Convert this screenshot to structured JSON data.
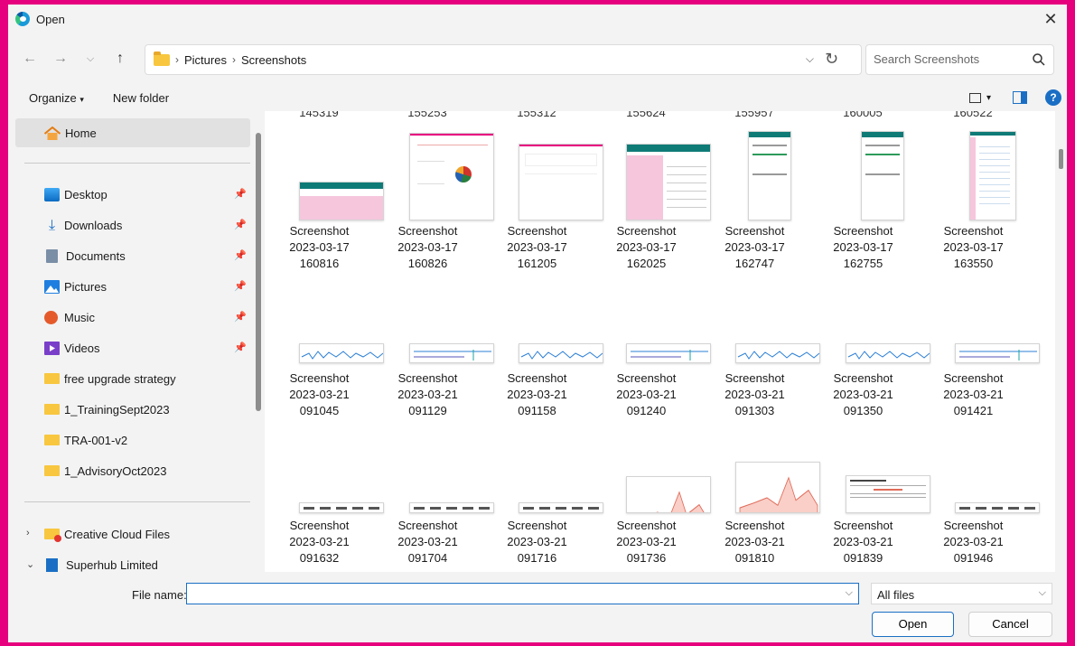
{
  "window": {
    "title": "Open"
  },
  "nav": {
    "back_icon": "arrow-left-icon",
    "forward_icon": "arrow-right-icon",
    "recent_icon": "chevron-down-icon",
    "up_icon": "arrow-up-icon",
    "breadcrumbs": [
      "Pictures",
      "Screenshots"
    ],
    "search_placeholder": "Search Screenshots"
  },
  "commands": {
    "organize": "Organize",
    "new_folder": "New folder"
  },
  "sidebar": {
    "home": "Home",
    "quick_access": [
      {
        "label": "Desktop",
        "icon": "desktop-icon"
      },
      {
        "label": "Downloads",
        "icon": "download-icon"
      },
      {
        "label": "Documents",
        "icon": "documents-icon"
      },
      {
        "label": "Pictures",
        "icon": "pictures-icon"
      },
      {
        "label": "Music",
        "icon": "music-icon"
      },
      {
        "label": "Videos",
        "icon": "videos-icon"
      }
    ],
    "folders": [
      "free upgrade strategy",
      "1_TrainingSept2023",
      "TRA-001-v2",
      "1_AdvisoryOct2023"
    ],
    "tree": [
      {
        "label": "Creative Cloud Files",
        "chevron": ">"
      },
      {
        "label": "Superhub Limited",
        "chevron": "v"
      }
    ]
  },
  "files": {
    "cut_labels": [
      "145319",
      "155253",
      "155312",
      "155624",
      "155957",
      "160005",
      "160522"
    ],
    "rows": [
      [
        {
          "name": "Screenshot",
          "date": "2023-03-17",
          "time": "160816"
        },
        {
          "name": "Screenshot",
          "date": "2023-03-17",
          "time": "160826"
        },
        {
          "name": "Screenshot",
          "date": "2023-03-17",
          "time": "161205"
        },
        {
          "name": "Screenshot",
          "date": "2023-03-17",
          "time": "162025"
        },
        {
          "name": "Screenshot",
          "date": "2023-03-17",
          "time": "162747"
        },
        {
          "name": "Screenshot",
          "date": "2023-03-17",
          "time": "162755"
        },
        {
          "name": "Screenshot",
          "date": "2023-03-17",
          "time": "163550"
        }
      ],
      [
        {
          "name": "Screenshot",
          "date": "2023-03-21",
          "time": "091045"
        },
        {
          "name": "Screenshot",
          "date": "2023-03-21",
          "time": "091129"
        },
        {
          "name": "Screenshot",
          "date": "2023-03-21",
          "time": "091158"
        },
        {
          "name": "Screenshot",
          "date": "2023-03-21",
          "time": "091240"
        },
        {
          "name": "Screenshot",
          "date": "2023-03-21",
          "time": "091303"
        },
        {
          "name": "Screenshot",
          "date": "2023-03-21",
          "time": "091350"
        },
        {
          "name": "Screenshot",
          "date": "2023-03-21",
          "time": "091421"
        }
      ],
      [
        {
          "name": "Screenshot",
          "date": "2023-03-21",
          "time": "091632"
        },
        {
          "name": "Screenshot",
          "date": "2023-03-21",
          "time": "091704"
        },
        {
          "name": "Screenshot",
          "date": "2023-03-21",
          "time": "091716"
        },
        {
          "name": "Screenshot",
          "date": "2023-03-21",
          "time": "091736"
        },
        {
          "name": "Screenshot",
          "date": "2023-03-21",
          "time": "091810"
        },
        {
          "name": "Screenshot",
          "date": "2023-03-21",
          "time": "091839"
        },
        {
          "name": "Screenshot",
          "date": "2023-03-21",
          "time": "091946"
        }
      ]
    ]
  },
  "bottom": {
    "file_name_label": "File name:",
    "file_name_value": "",
    "file_type": "All files",
    "open_label": "Open",
    "cancel_label": "Cancel"
  },
  "colors": {
    "frame_border": "#e6007e",
    "accent": "#1a6fc4",
    "folder": "#f8c73f",
    "thumb_pink": "#f6c6dd",
    "thumb_teal": "#0f7b77"
  }
}
